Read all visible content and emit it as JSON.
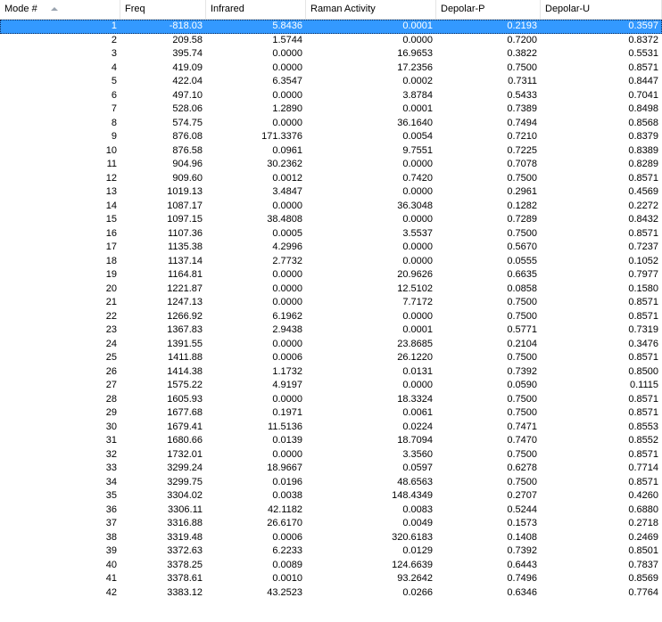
{
  "columns": [
    "Mode #",
    "Freq",
    "Infrared",
    "Raman Activity",
    "Depolar-P",
    "Depolar-U"
  ],
  "sort_icon": "sort-ascending-icon",
  "selected_row": 0,
  "colors": {
    "selection": "#3399ff",
    "header_border": "#e2e2e2"
  },
  "rows": [
    [
      "1",
      "-818.03",
      "5.8436",
      "0.0001",
      "0.2193",
      "0.3597"
    ],
    [
      "2",
      "209.58",
      "1.5744",
      "0.0000",
      "0.7200",
      "0.8372"
    ],
    [
      "3",
      "395.74",
      "0.0000",
      "16.9653",
      "0.3822",
      "0.5531"
    ],
    [
      "4",
      "419.09",
      "0.0000",
      "17.2356",
      "0.7500",
      "0.8571"
    ],
    [
      "5",
      "422.04",
      "6.3547",
      "0.0002",
      "0.7311",
      "0.8447"
    ],
    [
      "6",
      "497.10",
      "0.0000",
      "3.8784",
      "0.5433",
      "0.7041"
    ],
    [
      "7",
      "528.06",
      "1.2890",
      "0.0001",
      "0.7389",
      "0.8498"
    ],
    [
      "8",
      "574.75",
      "0.0000",
      "36.1640",
      "0.7494",
      "0.8568"
    ],
    [
      "9",
      "876.08",
      "171.3376",
      "0.0054",
      "0.7210",
      "0.8379"
    ],
    [
      "10",
      "876.58",
      "0.0961",
      "9.7551",
      "0.7225",
      "0.8389"
    ],
    [
      "11",
      "904.96",
      "30.2362",
      "0.0000",
      "0.7078",
      "0.8289"
    ],
    [
      "12",
      "909.60",
      "0.0012",
      "0.7420",
      "0.7500",
      "0.8571"
    ],
    [
      "13",
      "1019.13",
      "3.4847",
      "0.0000",
      "0.2961",
      "0.4569"
    ],
    [
      "14",
      "1087.17",
      "0.0000",
      "36.3048",
      "0.1282",
      "0.2272"
    ],
    [
      "15",
      "1097.15",
      "38.4808",
      "0.0000",
      "0.7289",
      "0.8432"
    ],
    [
      "16",
      "1107.36",
      "0.0005",
      "3.5537",
      "0.7500",
      "0.8571"
    ],
    [
      "17",
      "1135.38",
      "4.2996",
      "0.0000",
      "0.5670",
      "0.7237"
    ],
    [
      "18",
      "1137.14",
      "2.7732",
      "0.0000",
      "0.0555",
      "0.1052"
    ],
    [
      "19",
      "1164.81",
      "0.0000",
      "20.9626",
      "0.6635",
      "0.7977"
    ],
    [
      "20",
      "1221.87",
      "0.0000",
      "12.5102",
      "0.0858",
      "0.1580"
    ],
    [
      "21",
      "1247.13",
      "0.0000",
      "7.7172",
      "0.7500",
      "0.8571"
    ],
    [
      "22",
      "1266.92",
      "6.1962",
      "0.0000",
      "0.7500",
      "0.8571"
    ],
    [
      "23",
      "1367.83",
      "2.9438",
      "0.0001",
      "0.5771",
      "0.7319"
    ],
    [
      "24",
      "1391.55",
      "0.0000",
      "23.8685",
      "0.2104",
      "0.3476"
    ],
    [
      "25",
      "1411.88",
      "0.0006",
      "26.1220",
      "0.7500",
      "0.8571"
    ],
    [
      "26",
      "1414.38",
      "1.1732",
      "0.0131",
      "0.7392",
      "0.8500"
    ],
    [
      "27",
      "1575.22",
      "4.9197",
      "0.0000",
      "0.0590",
      "0.1115"
    ],
    [
      "28",
      "1605.93",
      "0.0000",
      "18.3324",
      "0.7500",
      "0.8571"
    ],
    [
      "29",
      "1677.68",
      "0.1971",
      "0.0061",
      "0.7500",
      "0.8571"
    ],
    [
      "30",
      "1679.41",
      "11.5136",
      "0.0224",
      "0.7471",
      "0.8553"
    ],
    [
      "31",
      "1680.66",
      "0.0139",
      "18.7094",
      "0.7470",
      "0.8552"
    ],
    [
      "32",
      "1732.01",
      "0.0000",
      "3.3560",
      "0.7500",
      "0.8571"
    ],
    [
      "33",
      "3299.24",
      "18.9667",
      "0.0597",
      "0.6278",
      "0.7714"
    ],
    [
      "34",
      "3299.75",
      "0.0196",
      "48.6563",
      "0.7500",
      "0.8571"
    ],
    [
      "35",
      "3304.02",
      "0.0038",
      "148.4349",
      "0.2707",
      "0.4260"
    ],
    [
      "36",
      "3306.11",
      "42.1182",
      "0.0083",
      "0.5244",
      "0.6880"
    ],
    [
      "37",
      "3316.88",
      "26.6170",
      "0.0049",
      "0.1573",
      "0.2718"
    ],
    [
      "38",
      "3319.48",
      "0.0006",
      "320.6183",
      "0.1408",
      "0.2469"
    ],
    [
      "39",
      "3372.63",
      "6.2233",
      "0.0129",
      "0.7392",
      "0.8501"
    ],
    [
      "40",
      "3378.25",
      "0.0089",
      "124.6639",
      "0.6443",
      "0.7837"
    ],
    [
      "41",
      "3378.61",
      "0.0010",
      "93.2642",
      "0.7496",
      "0.8569"
    ],
    [
      "42",
      "3383.12",
      "43.2523",
      "0.0266",
      "0.6346",
      "0.7764"
    ]
  ]
}
